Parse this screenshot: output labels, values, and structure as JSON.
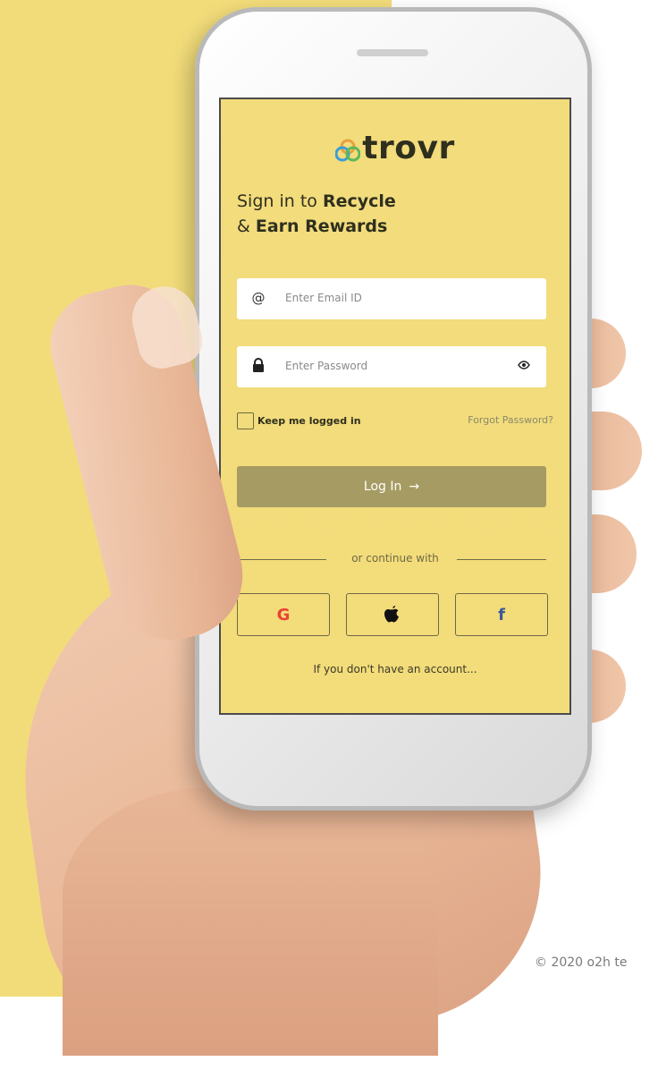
{
  "app": {
    "logo_text": "trovr",
    "headline": {
      "line1_prefix": "Sign in to ",
      "line1_bold": "Recycle",
      "line2_prefix": "& ",
      "line2_bold": "Earn Rewards"
    },
    "email": {
      "icon": "at-icon",
      "placeholder": "Enter Email ID"
    },
    "password": {
      "icon": "lock-icon",
      "placeholder": "Enter Password",
      "toggle_icon": "eye-icon"
    },
    "remember_label": "Keep me logged in",
    "remember_checked": false,
    "forgot_label": "Forgot Password?",
    "login_label": "Log In",
    "login_icon": "arrow-right-icon",
    "divider_text": "or continue with",
    "social": [
      {
        "name": "google",
        "icon": "google-icon"
      },
      {
        "name": "apple",
        "icon": "apple-icon"
      },
      {
        "name": "facebook",
        "icon": "facebook-icon"
      }
    ],
    "signup_prompt": "If you don't have an account..."
  },
  "footer": {
    "copyright": "© 2020 o2h te"
  },
  "colors": {
    "background_yellow": "#f2dc7a",
    "screen_yellow": "#f2dc7c",
    "button_olive": "#a69b63",
    "text_dark": "#2f2f1e"
  }
}
